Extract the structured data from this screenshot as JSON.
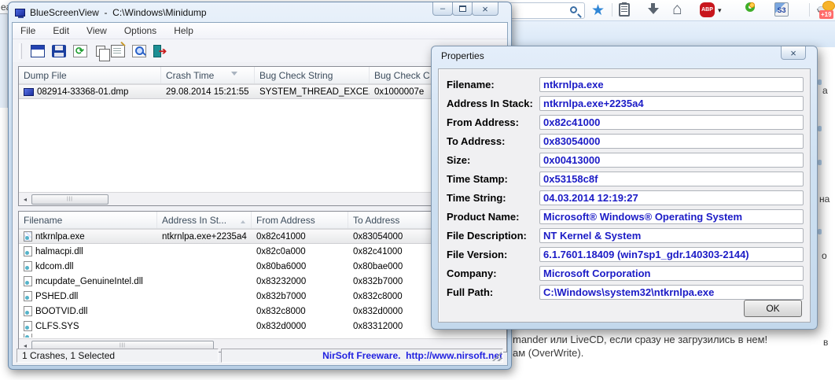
{
  "browser": {
    "icons": [
      "search-icon",
      "bookmark-star-icon",
      "clipboard-icon",
      "download-arrow-icon",
      "home-icon",
      "adblock-abp-icon",
      "dropdown-caret-icon",
      "green-ring-icon",
      "s3-translator-icon",
      "dropdown-caret-icon",
      "weather-icon"
    ],
    "abp_label": "ABP",
    "s3_label": "S3",
    "weather_badge": "+19",
    "page_fragments": {
      "top_left": "ea",
      "line1": "mander или LiveCD, если сразу не загрузились в нем!",
      "line2": "ам (OverWrite).",
      "edge1": "а",
      "edge2": "на",
      "edge3": "о",
      "edge4": "в"
    }
  },
  "app": {
    "title": "BlueScreenView  -  C:\\Windows\\Minidump",
    "window_buttons": {
      "minimize": "–",
      "close": "×"
    },
    "menu": [
      "File",
      "Edit",
      "View",
      "Options",
      "Help"
    ],
    "toolbar_icons": [
      "window-options",
      "save",
      "refresh",
      "copy",
      "properties",
      "find",
      "exit"
    ],
    "upper_table": {
      "columns": [
        "Dump File",
        "Crash Time",
        "Bug Check String",
        "Bug Check C"
      ],
      "rows": [
        [
          "082914-33368-01.dmp",
          "29.08.2014 15:21:55",
          "SYSTEM_THREAD_EXCE...",
          "0x1000007e"
        ]
      ]
    },
    "lower_table": {
      "columns": [
        "Filename",
        "Address In St...",
        "From Address",
        "To Address"
      ],
      "rows": [
        [
          "ntkrnlpa.exe",
          "ntkrnlpa.exe+2235a4",
          "0x82c41000",
          "0x83054000"
        ],
        [
          "halmacpi.dll",
          "",
          "0x82c0a000",
          "0x82c41000"
        ],
        [
          "kdcom.dll",
          "",
          "0x80ba6000",
          "0x80bae000"
        ],
        [
          "mcupdate_GenuineIntel.dll",
          "",
          "0x83232000",
          "0x832b7000"
        ],
        [
          "PSHED.dll",
          "",
          "0x832b7000",
          "0x832c8000"
        ],
        [
          "BOOTVID.dll",
          "",
          "0x832c8000",
          "0x832d0000"
        ],
        [
          "CLFS.SYS",
          "",
          "0x832d0000",
          "0x83312000"
        ]
      ]
    },
    "status_left": "1 Crashes, 1 Selected",
    "status_right": "NirSoft Freeware.  http://www.nirsoft.net",
    "scroll_glyphs": {
      "left": "◂",
      "right": "▸",
      "grip": "|||"
    }
  },
  "dialog": {
    "title": "Properties",
    "close_glyph": "×",
    "ok_label": "OK",
    "fields": [
      {
        "label": "Filename:",
        "value": "ntkrnlpa.exe"
      },
      {
        "label": "Address In Stack:",
        "value": "ntkrnlpa.exe+2235a4"
      },
      {
        "label": "From Address:",
        "value": "0x82c41000"
      },
      {
        "label": "To Address:",
        "value": "0x83054000"
      },
      {
        "label": "Size:",
        "value": "0x00413000"
      },
      {
        "label": "Time Stamp:",
        "value": "0x53158c8f"
      },
      {
        "label": "Time String:",
        "value": "04.03.2014 12:19:27"
      },
      {
        "label": "Product Name:",
        "value": "Microsoft® Windows® Operating System"
      },
      {
        "label": "File Description:",
        "value": "NT Kernel & System"
      },
      {
        "label": "File Version:",
        "value": "6.1.7601.18409 (win7sp1_gdr.140303-2144)"
      },
      {
        "label": "Company:",
        "value": "Microsoft Corporation"
      },
      {
        "label": "Full Path:",
        "value": "C:\\Windows\\system32\\ntkrnlpa.exe"
      }
    ]
  },
  "colors": {
    "dialog_value_text": "#1b1bc6",
    "status_link": "#2222e0",
    "aero_glass": "#cfe1f2",
    "abp_red": "#c8161d",
    "star_blue": "#2f86d6",
    "refresh_green": "#1e9e30",
    "exit_teal": "#1d8f94",
    "weather_badge_red": "#ff6b6b",
    "selected_row": "#e7e8ea"
  }
}
